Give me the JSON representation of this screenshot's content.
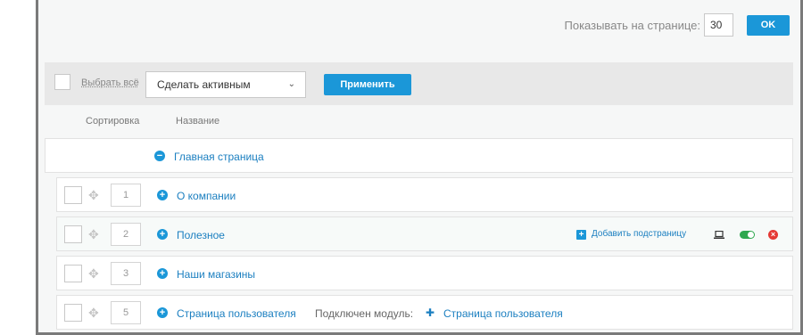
{
  "toolbar": {
    "per_page_label": "Показывать на странице:",
    "per_page_value": "30",
    "ok_label": "OK"
  },
  "bulk": {
    "select_all_label": "Выбрать всё",
    "action_selected": "Сделать активным",
    "apply_label": "Применить"
  },
  "columns": {
    "sort": "Сортировка",
    "name": "Название"
  },
  "root": {
    "title": "Главная страница",
    "toggle": "−"
  },
  "rows": [
    {
      "sort": "1",
      "title": "О компании",
      "toggle": "+"
    },
    {
      "sort": "2",
      "title": "Полезное",
      "toggle": "+",
      "add_subpage_label": "Добавить подстраницу"
    },
    {
      "sort": "3",
      "title": "Наши магазины",
      "toggle": "+"
    },
    {
      "sort": "5",
      "title": "Страница пользователя",
      "toggle": "+",
      "module_label": "Подключен модуль:",
      "module_name": "Страница пользователя"
    }
  ],
  "icons": {
    "drag": "drag-handle-icon",
    "expand": "plus-circle-icon",
    "collapse": "minus-circle-icon",
    "add": "plus-square-icon",
    "laptop": "laptop-icon",
    "toggle": "toggle-on-icon",
    "delete": "close-circle-icon",
    "module": "puzzle-icon",
    "dropdown": "chevron-down-icon"
  },
  "colors": {
    "accent": "#1b97d8",
    "link": "#1b7fc0",
    "active": "#2fa84f",
    "danger": "#e53935"
  }
}
